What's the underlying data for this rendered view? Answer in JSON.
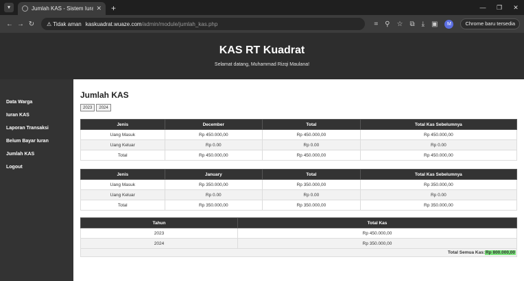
{
  "browser": {
    "tab_title": "Jumlah KAS - Sistem Iuran KAS",
    "security_label": "Tidak aman",
    "url_host": "kaskuadrat.wuaze.com",
    "url_path": "/admin/module/jumlah_kas.php",
    "update_label": "Chrome baru tersedia",
    "profile_initial": "M"
  },
  "header": {
    "title": "KAS RT Kuadrat",
    "welcome": "Selamat datang, Muhammad Rizqi Maulana!"
  },
  "sidebar": {
    "items": [
      {
        "label": "Data Warga"
      },
      {
        "label": "Iuran KAS"
      },
      {
        "label": "Laporan Transaksi"
      },
      {
        "label": "Belum Bayar Iuran"
      },
      {
        "label": "Jumlah KAS"
      },
      {
        "label": "Logout"
      }
    ]
  },
  "main": {
    "title": "Jumlah KAS",
    "years": [
      "2023",
      "2024"
    ]
  },
  "table_december": {
    "headers": [
      "Jenis",
      "December",
      "Total",
      "Total Kas Sebelumnya"
    ],
    "rows": [
      [
        "Uang Masuk",
        "Rp 450.000,00",
        "Rp 450.000,00",
        "Rp 450.000,00"
      ],
      [
        "Uang Keluar",
        "Rp 0.00",
        "Rp 0.00",
        "Rp 0.00"
      ],
      [
        "Total",
        "Rp 450.000,00",
        "Rp 450.000,00",
        "Rp 450.000,00"
      ]
    ]
  },
  "table_january": {
    "headers": [
      "Jenis",
      "January",
      "Total",
      "Total Kas Sebelumnya"
    ],
    "rows": [
      [
        "Uang Masuk",
        "Rp 350.000,00",
        "Rp 350.000,00",
        "Rp 350.000,00"
      ],
      [
        "Uang Keluar",
        "Rp 0.00",
        "Rp 0.00",
        "Rp 0.00"
      ],
      [
        "Total",
        "Rp 350.000,00",
        "Rp 350.000,00",
        "Rp 350.000,00"
      ]
    ]
  },
  "table_years": {
    "headers": [
      "Tahun",
      "Total Kas"
    ],
    "rows": [
      [
        "2023",
        "Rp 450.000,00"
      ],
      [
        "2024",
        "Rp 350.000,00"
      ]
    ]
  },
  "summary": {
    "label": "Total Semua Kas:",
    "amount": "Rp 800.000,00",
    "highlight_color": "#7be37b"
  }
}
